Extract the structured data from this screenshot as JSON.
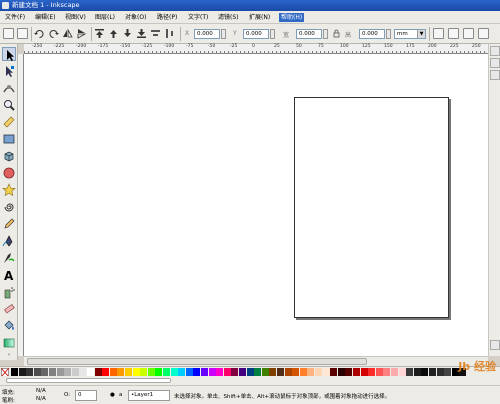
{
  "window": {
    "title": "新建文档 1 - Inkscape"
  },
  "menu": [
    {
      "label": "文件(F)"
    },
    {
      "label": "编辑(E)"
    },
    {
      "label": "视图(V)"
    },
    {
      "label": "图层(L)"
    },
    {
      "label": "对象(O)"
    },
    {
      "label": "路径(P)"
    },
    {
      "label": "文字(T)"
    },
    {
      "label": "滤镜(S)"
    },
    {
      "label": "扩展(N)"
    },
    {
      "label": "帮助(H)"
    }
  ],
  "toolbar": {
    "x_label": "X",
    "x_value": "0.000",
    "y_label": "Y",
    "y_value": "0.000",
    "w_label": "宽",
    "w_value": "0.000",
    "h_label": "高",
    "h_value": "0.000",
    "unit": "mm"
  },
  "ruler": {
    "labels": [
      "-250",
      "-225",
      "-200",
      "-175",
      "-150",
      "-125",
      "-100",
      "-75",
      "-50",
      "-25",
      "0",
      "25",
      "50",
      "75",
      "100",
      "125",
      "150",
      "175",
      "200",
      "225",
      "250"
    ]
  },
  "tools": [
    "selector-tool-icon",
    "node-tool-icon",
    "tweak-tool-icon",
    "zoom-tool-icon",
    "measure-tool-icon",
    "rectangle-tool-icon",
    "3d-box-tool-icon",
    "ellipse-tool-icon",
    "star-tool-icon",
    "spiral-tool-icon",
    "pencil-tool-icon",
    "pen-tool-icon",
    "calligraphy-tool-icon",
    "text-tool-icon",
    "spray-tool-icon",
    "eraser-tool-icon",
    "paint-bucket-tool-icon",
    "gradient-tool-icon"
  ],
  "palette": {
    "colors": [
      "#000000",
      "#1a1a1a",
      "#333333",
      "#4d4d4d",
      "#666666",
      "#808080",
      "#999999",
      "#b3b3b3",
      "#cccccc",
      "#e6e6e6",
      "#ffffff",
      "#800000",
      "#ff0000",
      "#ff6600",
      "#ff9900",
      "#ffcc00",
      "#ffff00",
      "#ccff00",
      "#66ff00",
      "#00ff00",
      "#00ff66",
      "#00ffcc",
      "#00ccff",
      "#0066ff",
      "#0000ff",
      "#6600ff",
      "#cc00ff",
      "#ff00cc",
      "#ff0066",
      "#800040",
      "#400080",
      "#004080",
      "#008040",
      "#408000",
      "#804000",
      "#502d16",
      "#aa4400",
      "#d45500",
      "#ff7f2a",
      "#ffb380",
      "#ffd5b3",
      "#ffe6d5",
      "#5a0000",
      "#2b0000",
      "#550000",
      "#aa0000",
      "#d40000",
      "#ff2a2a",
      "#ff5555",
      "#ff8080",
      "#ffaaaa",
      "#ffd5d5",
      "#3a3a3a",
      "#1c1c1c",
      "#0a0a0a",
      "#222222",
      "#2e2e2e",
      "#444444",
      "#000000",
      "#111111"
    ]
  },
  "status": {
    "fill_label": "填充:",
    "fill_value": "N/A",
    "stroke_label": "笔刷:",
    "stroke_value": "N/A",
    "opacity_label": "O:",
    "opacity_value": "0",
    "layer": "•Layer1",
    "message": "未选择对象。单击、Shift+单击、Alt+滚动鼠标于对象顶部，或围着对象拖动进行选择。"
  },
  "watermark": "Jb 经验"
}
